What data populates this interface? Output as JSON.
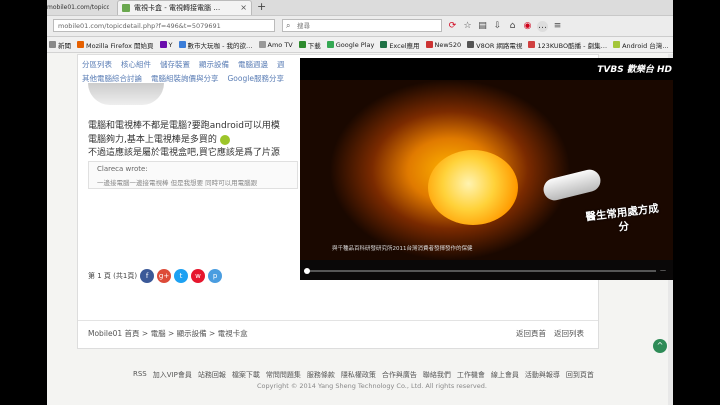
{
  "browser": {
    "url_stub": "mobile01.com/topicdetail.php?f=496&t=5079691",
    "tab_title": "電視卡盒 - 電視轉接電腦 …",
    "tab_close": "×",
    "new_tab": "+",
    "url": "mobile01.com/topicdetail.php?f=496&t=5079691",
    "search_placeholder": "搜尋",
    "toolbar_icons": [
      "reload-icon",
      "star-icon",
      "bookmark-list-icon",
      "download-icon",
      "home-icon",
      "shield-icon",
      "chat-icon",
      "menu-icon"
    ]
  },
  "bookmarks": [
    {
      "label": "新聞",
      "color": "#888888"
    },
    {
      "label": "Mozilla Firefox 開始頁",
      "color": "#e66000"
    },
    {
      "label": "Y",
      "color": "#6b0eac"
    },
    {
      "label": "數市大玩咖 - 我的欲…",
      "color": "#3b7dd8"
    },
    {
      "label": "Amo TV",
      "color": "#999999"
    },
    {
      "label": "下載",
      "color": "#2d8a2d"
    },
    {
      "label": "Google Play",
      "color": "#34a853"
    },
    {
      "label": "Excel應用",
      "color": "#1e7145"
    },
    {
      "label": "New520",
      "color": "#cc3333"
    },
    {
      "label": "V8OR 網路電視",
      "color": "#555555"
    },
    {
      "label": "123KUBO酷播 - 劇集…",
      "color": "#d04040"
    },
    {
      "label": "Android 台灣…",
      "color": "#a4c639"
    }
  ],
  "forum": {
    "nav_row1": [
      "分區列表",
      "核心組件",
      "儲存裝置",
      "顯示設備",
      "電腦週邊",
      "週"
    ],
    "nav_row2": [
      "其他電腦綜合討論",
      "電腦組裝詢價與分享",
      "Google服務分享"
    ],
    "line1": "電腦和電視棒不都是電腦?要跑android可以用模",
    "line2": "電腦夠力,基本上電視棒是多買的",
    "line3": "不過這應該是屬於電視盒吧,買它應該是爲了片源",
    "quote_author": "Clareca wrote:",
    "quote_text": "一邊接電腦一邊接電視棒 但是我想要 同時可以用電腦跟",
    "pager": "第 1 頁 (共1頁)",
    "share_icons": [
      {
        "name": "facebook-icon",
        "glyph": "f",
        "color": "#3b5998"
      },
      {
        "name": "google-plus-icon",
        "glyph": "g+",
        "color": "#dd4b39"
      },
      {
        "name": "twitter-icon",
        "glyph": "t",
        "color": "#1da1f2"
      },
      {
        "name": "weibo-icon",
        "glyph": "w",
        "color": "#e6162d"
      },
      {
        "name": "plurk-icon",
        "glyph": "p",
        "color": "#4a9de0"
      }
    ],
    "breadcrumb": "Mobile01 首頁 > 電腦 > 顯示設備 > 電視卡盒",
    "back_list": "返回頁首",
    "back_list2": "返回列表"
  },
  "footer": {
    "links": [
      "RSS",
      "加入VIP會員",
      "站務回報",
      "檔案下載",
      "常問問題集",
      "服務條款",
      "隱私權政策",
      "合作與廣告",
      "聯絡我們",
      "工作機會",
      "線上會員",
      "活動與報導",
      "回到頁首"
    ],
    "copyright": "Copyright © 2014 Yang Sheng Technology Co., Ltd. All rights reserved."
  },
  "video": {
    "channel_logo": "TVBS 歡樂台 HD",
    "slogan": "醫生常用處方成分",
    "subtitle": "與千種品百科研發研究所2011台灣消費者發揮發作的保健",
    "up_glyph": "^"
  }
}
